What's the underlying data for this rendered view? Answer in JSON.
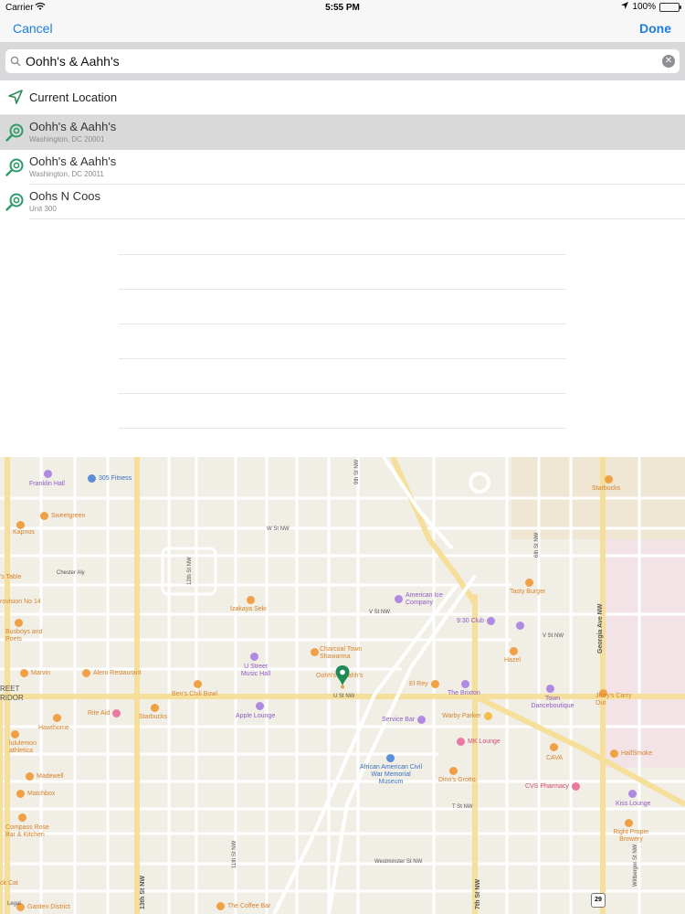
{
  "status_bar": {
    "carrier": "Carrier",
    "time": "5:55 PM",
    "battery": "100%"
  },
  "nav": {
    "cancel": "Cancel",
    "done": "Done"
  },
  "search": {
    "value": "Oohh's & Aahh's"
  },
  "current_location": "Current Location",
  "results": [
    {
      "title": "Oohh's & Aahh's",
      "subtitle": "Washington, DC  20001"
    },
    {
      "title": "Oohh's & Aahh's",
      "subtitle": "Washington, DC  20011"
    },
    {
      "title": "Oohs N Coos",
      "subtitle": "Unit 300"
    }
  ],
  "map": {
    "pois": {
      "franklin_hall": "Franklin Hall",
      "fitness_305": "305 Fitness",
      "sweetgreen": "Sweetgreen",
      "kapnos": "Kapnos",
      "chester_aly": "Chester Aly",
      "s_table": "'s Table",
      "provision": "rovision No 14",
      "busboys": "Busboys and Poets",
      "marvin": "Marvin",
      "alero": "Alero Restaurant",
      "bens": "Ben's Chili Bowl",
      "u_street_music": "U Street Music Hall",
      "izakaya": "Izakaya Seki",
      "charcoal": "Charcoal Town Shawarma",
      "oohhs": "Oohh's & Aahh's",
      "american_ice": "American Ice Company",
      "nine_thirty": "9:30 Club",
      "el_rey": "El Rey",
      "the_brixton": "The Brixton",
      "hazel": "Hazel",
      "tasty_burger": "Tasty Burger",
      "starbucks_top": "Starbucks",
      "town_dance": "Town Danceboutique",
      "jerrys": "Jerry's Carry Out",
      "warby": "Warby Parker",
      "service_bar": "Service Bar",
      "mk_lounge": "MK Lounge",
      "cava": "CAVA",
      "halfsmoke": "HalfSmoke",
      "african_american": "African American Civil War Memorial Museum",
      "oohs_grotto": "Dino's Grotto",
      "cvs": "CVS Pharmacy",
      "kiss_lounge": "Kiss Lounge",
      "right_proper": "Right Proper Brewery",
      "rite_aid": "Rite Aid",
      "starbucks_bottom": "Starbucks",
      "apple_lounge": "Apple Lounge",
      "hawthorne": "Hawthorne",
      "lululemon": "lululemon athletica",
      "madewell": "Madewell",
      "matchbox": "Matchbox",
      "compass_rose": "Compass Rose Bar & Kitchen",
      "garden_district": "Garden District",
      "coffee_bar": "The Coffee Bar",
      "ck_cat": "ck Cat",
      "street_corridor": "REET RIDOR"
    },
    "streets": {
      "w_st": "W St NW",
      "v_st": "V St NW",
      "v_st_right": "V St NW",
      "u_st": "U St NW",
      "t_st": "T St NW",
      "westminster": "Westminster St NW",
      "st12": "12th St NW",
      "st13": "13th St NW",
      "st11": "11th St NW",
      "st7": "7th St NW",
      "georgia": "Georgia Ave NW",
      "legal": "Legal",
      "route": "29",
      "wiltberger": "Wiltberger St NW",
      "st6": "6th St NW",
      "st9": "9th St NW"
    }
  }
}
